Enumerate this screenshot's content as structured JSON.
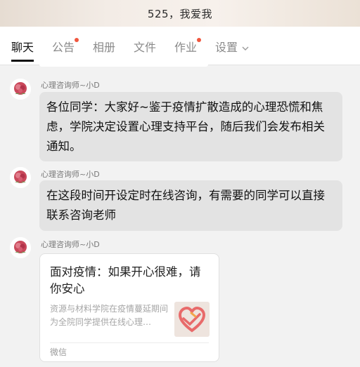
{
  "header": {
    "title": "525，我爱我"
  },
  "tabs": [
    {
      "label": "聊天",
      "active": true,
      "badge": false
    },
    {
      "label": "公告",
      "active": false,
      "badge": true
    },
    {
      "label": "相册",
      "active": false,
      "badge": false
    },
    {
      "label": "文件",
      "active": false,
      "badge": false
    },
    {
      "label": "作业",
      "active": false,
      "badge": true
    },
    {
      "label": "设置",
      "active": false,
      "badge": false,
      "dropdown": true
    }
  ],
  "messages": [
    {
      "sender": "心理咨询师~小D",
      "text": "各位同学：大家好~鉴于疫情扩散造成的心理恐慌和焦虑，学院决定设置心理支持平台，随后我们会发布相关通知。"
    },
    {
      "sender": "心理咨询师~小D",
      "text": "在这段时间开设定时在线咨询，有需要的同学可以直接联系咨询老师"
    },
    {
      "sender": "心理咨询师~小D",
      "card": {
        "title": "面对疫情：如果开心很难，请你安心",
        "description": "资源与材料学院在疫情蔓延期间为全院同学提供在线心理…",
        "source": "微信",
        "thumbnail_icon": "heart-hand-logo-icon"
      }
    }
  ],
  "colors": {
    "bubble": "#e3e3e3",
    "badge": "#f0563e",
    "active_tab": "#111111",
    "inactive_tab": "#8a8a8a"
  }
}
